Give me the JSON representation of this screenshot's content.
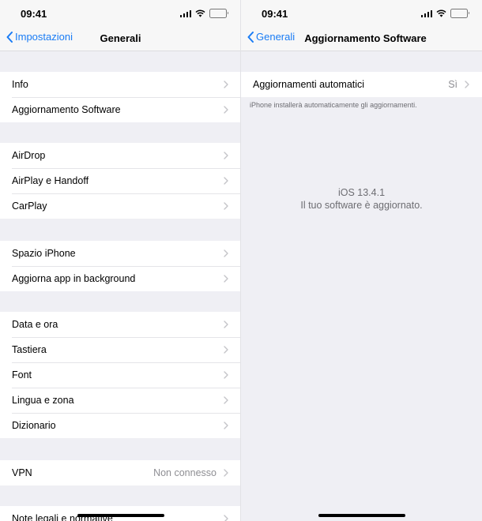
{
  "status": {
    "time": "09:41"
  },
  "left": {
    "back_label": "Impostazioni",
    "title": "Generali",
    "groups": [
      [
        {
          "label": "Info"
        },
        {
          "label": "Aggiornamento Software"
        }
      ],
      [
        {
          "label": "AirDrop"
        },
        {
          "label": "AirPlay e Handoff"
        },
        {
          "label": "CarPlay"
        }
      ],
      [
        {
          "label": "Spazio iPhone"
        },
        {
          "label": "Aggiorna app in background"
        }
      ],
      [
        {
          "label": "Data e ora"
        },
        {
          "label": "Tastiera"
        },
        {
          "label": "Font"
        },
        {
          "label": "Lingua e zona"
        },
        {
          "label": "Dizionario"
        }
      ],
      [
        {
          "label": "VPN",
          "value": "Non connesso"
        }
      ],
      [
        {
          "label": "Note legali e normative"
        }
      ]
    ]
  },
  "right": {
    "back_label": "Generali",
    "title": "Aggiornamento Software",
    "auto_updates": {
      "label": "Aggiornamenti automatici",
      "value": "Sì"
    },
    "footnote": "iPhone installerà automaticamente gli aggiornamenti.",
    "version": "iOS 13.4.1",
    "status_message": "Il tuo software è aggiornato."
  },
  "colors": {
    "accent": "#1a7cf5",
    "background": "#efeff4",
    "secondary_text": "#8e8e93"
  },
  "icons": {
    "back": "chevron-left-icon",
    "disclosure": "chevron-right-icon",
    "signal": "cellular-signal-icon",
    "wifi": "wifi-icon",
    "battery": "battery-icon"
  }
}
